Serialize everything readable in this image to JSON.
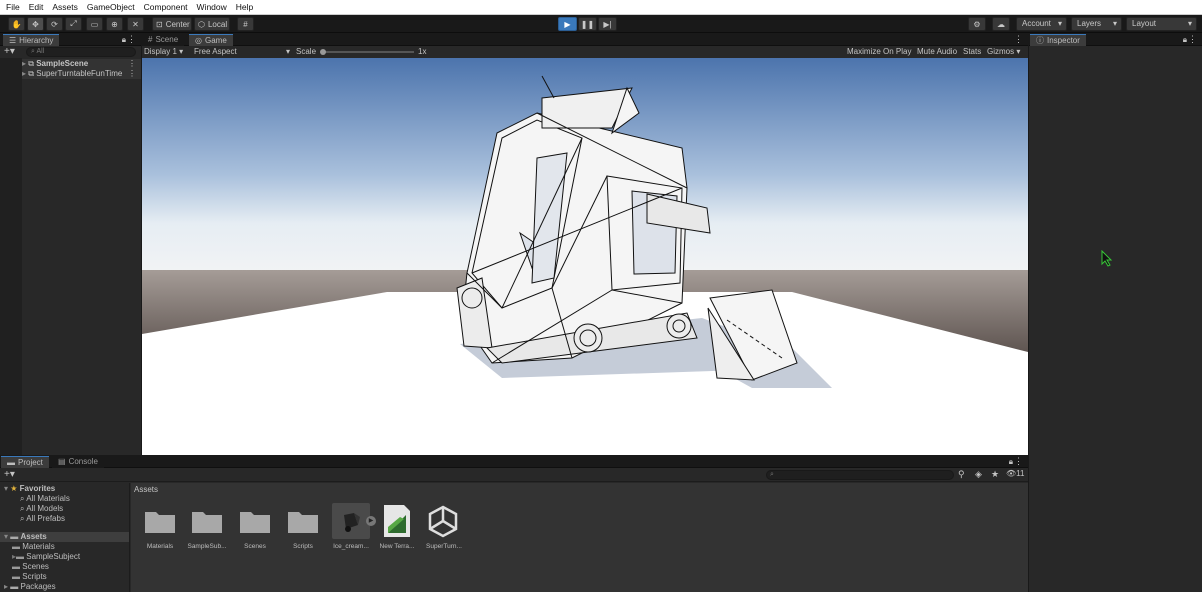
{
  "menu": [
    "File",
    "Edit",
    "Assets",
    "GameObject",
    "Component",
    "Window",
    "Help"
  ],
  "toolbar": {
    "pivot_label": "Center",
    "space_label": "Local",
    "account_label": "Account",
    "layers_label": "Layers",
    "layout_label": "Layout"
  },
  "hierarchy": {
    "tab_label": "Hierarchy",
    "search_placeholder": "All",
    "items": [
      "SampleScene",
      "SuperTurntableFunTime"
    ]
  },
  "scene_tab": "Scene",
  "game": {
    "tab_label": "Game",
    "display": "Display 1",
    "aspect": "Free Aspect",
    "scale_label": "Scale",
    "scale_value": "1x",
    "maximize": "Maximize On Play",
    "mute": "Mute Audio",
    "stats": "Stats",
    "gizmos": "Gizmos"
  },
  "inspector": {
    "tab_label": "Inspector"
  },
  "project": {
    "tab_label": "Project",
    "console_label": "Console",
    "hidden_count": "11",
    "favorites_label": "Favorites",
    "favorites": [
      "All Materials",
      "All Models",
      "All Prefabs"
    ],
    "assets_label": "Assets",
    "asset_folders": [
      "Materials",
      "SampleSubject",
      "Scenes",
      "Scripts"
    ],
    "packages_label": "Packages",
    "breadcrumb": "Assets",
    "grid_items": [
      "Materials",
      "SampleSub...",
      "Scenes",
      "Scripts",
      "Ice_cream...",
      "New Terra...",
      "SuperTurn..."
    ]
  },
  "colors": {
    "accent": "#3a79bb",
    "sky_top": "#4f77b0",
    "horizon": "#dde6f0",
    "ground_dark": "#5a504c",
    "floor": "#ffffff",
    "cursor": "#37c837"
  }
}
